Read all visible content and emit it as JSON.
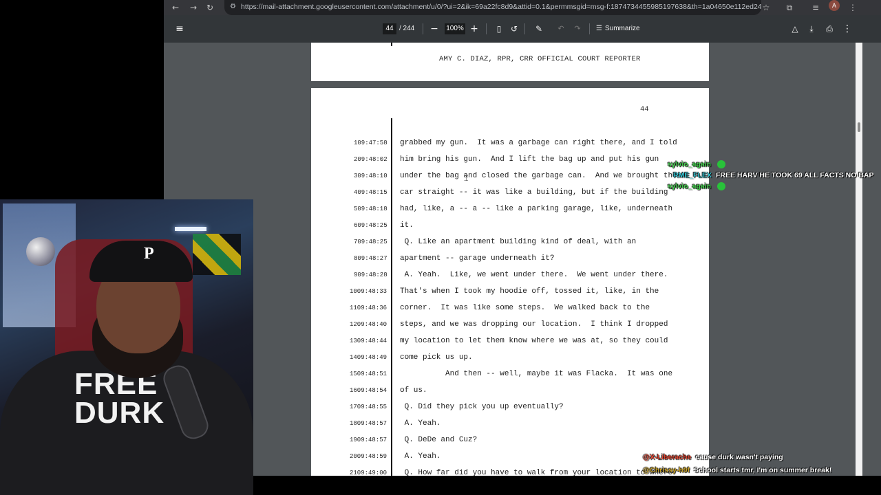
{
  "browser": {
    "url": "https://mail-attachment.googleusercontent.com/attachment/u/0/?ui=2&ik=69a22fc8d9&attid=0.1&permmsgid=msg-f:1874734455985197638&th=1a04650e112ed246...",
    "avatar_letter": "A"
  },
  "pdf_toolbar": {
    "current_page": "44",
    "total_pages": "/ 244",
    "zoom": "100%",
    "summarize_label": "Summarize"
  },
  "document": {
    "prev_page_footer": "AMY C. DIAZ, RPR, CRR OFFICIAL COURT REPORTER",
    "page_number": "44",
    "lines": [
      {
        "num": "1",
        "time": "09:47:58",
        "text": "grabbed my gun.  It was a garbage can right there, and I told"
      },
      {
        "num": "2",
        "time": "09:48:02",
        "text": "him bring his gun.  And I lift the bag up and put his gun"
      },
      {
        "num": "3",
        "time": "09:48:10",
        "text": "under the bag and closed the garbage can.  And we brought the"
      },
      {
        "num": "4",
        "time": "09:48:15",
        "text": "car straight -- it was like a building, but if the building"
      },
      {
        "num": "5",
        "time": "09:48:18",
        "text": "had, like, a -- a -- like a parking garage, like, underneath"
      },
      {
        "num": "6",
        "time": "09:48:25",
        "text": "it."
      },
      {
        "num": "7",
        "time": "09:48:25",
        "text": " Q. Like an apartment building kind of deal, with an"
      },
      {
        "num": "8",
        "time": "09:48:27",
        "text": "apartment -- garage underneath it?"
      },
      {
        "num": "9",
        "time": "09:48:28",
        "text": " A. Yeah.  Like, we went under there.  We went under there."
      },
      {
        "num": "10",
        "time": "09:48:33",
        "text": "That's when I took my hoodie off, tossed it, like, in the"
      },
      {
        "num": "11",
        "time": "09:48:36",
        "text": "corner.  It was like some steps.  We walked back to the"
      },
      {
        "num": "12",
        "time": "09:48:40",
        "text": "steps, and we was dropping our location.  I think I dropped"
      },
      {
        "num": "13",
        "time": "09:48:44",
        "text": "my location to let them know where we was at, so they could"
      },
      {
        "num": "14",
        "time": "09:48:49",
        "text": "come pick us up."
      },
      {
        "num": "15",
        "time": "09:48:51",
        "text": "          And then -- well, maybe it was Flacka.  It was one"
      },
      {
        "num": "16",
        "time": "09:48:54",
        "text": "of us."
      },
      {
        "num": "17",
        "time": "09:48:55",
        "text": " Q. Did they pick you up eventually?"
      },
      {
        "num": "18",
        "time": "09:48:57",
        "text": " A. Yeah."
      },
      {
        "num": "19",
        "time": "09:48:57",
        "text": " Q. DeDe and Cuz?"
      },
      {
        "num": "20",
        "time": "09:48:59",
        "text": " A. Yeah."
      },
      {
        "num": "21",
        "time": "09:49:00",
        "text": " Q. How far did you have to walk from your location to where"
      }
    ]
  },
  "webcam": {
    "cap_logo": "P",
    "hoodie_text": "FREE\nDURK"
  },
  "chat": [
    {
      "user": "sylvio_again",
      "message": "",
      "user_color": "#3fd14a"
    },
    {
      "user": "RME_FLEX",
      "message": "FREE HARV HE TOOK 69 ALL FACTS NO BAP",
      "user_color": "#2fc7d6"
    },
    {
      "user": "sylvio_again",
      "message": "",
      "user_color": "#3fd14a"
    },
    {
      "user": "@X-Liberache",
      "message": "cause durk wasn't paying",
      "user_color": "#e0442f"
    },
    {
      "user": "@Chrissy-h9f",
      "message": "School starts tmr, I'm on summer break!",
      "user_color": "#c9a227"
    }
  ]
}
